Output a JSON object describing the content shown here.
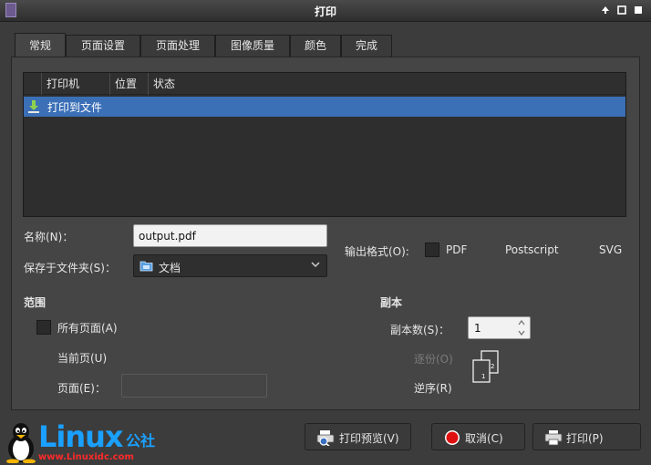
{
  "window": {
    "title": "打印"
  },
  "tabs": [
    "常规",
    "页面设置",
    "页面处理",
    "图像质量",
    "颜色",
    "完成"
  ],
  "printer_list": {
    "columns": [
      "打印机",
      "位置",
      "状态"
    ],
    "rows": [
      {
        "name": "打印到文件",
        "location": "",
        "status": ""
      }
    ]
  },
  "name": {
    "label": "名称(N)：",
    "value": "output.pdf"
  },
  "folder": {
    "label": "保存于文件夹(S)：",
    "value": "文档"
  },
  "output_format": {
    "label": "输出格式(O):",
    "options": [
      "PDF",
      "Postscript",
      "SVG"
    ]
  },
  "range": {
    "heading": "范围",
    "all_pages": "所有页面(A)",
    "current_page": "当前页(U)",
    "pages_label": "页面(E)：",
    "pages_value": ""
  },
  "copies": {
    "heading": "副本",
    "count_label": "副本数(S)：",
    "count_value": "1",
    "collate": "逐份(O)",
    "reverse": "逆序(R)"
  },
  "buttons": {
    "preview": "打印预览(V)",
    "cancel": "取消(C)",
    "print": "打印(P)"
  },
  "watermark": {
    "brand": "Linux",
    "brand_suffix": "公社",
    "url": "www.Linuxidc.com"
  },
  "colors": {
    "selection": "#3b6fb6",
    "cancel_icon": "#e01010",
    "brand": "#1aa0ff",
    "url": "#ff2a2a"
  }
}
